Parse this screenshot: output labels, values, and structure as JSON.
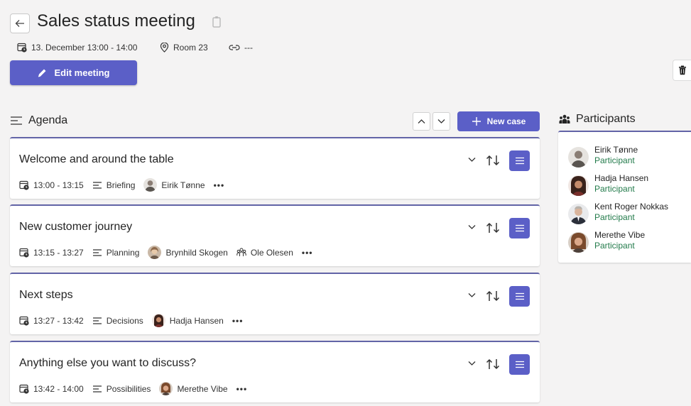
{
  "header": {
    "title": "Sales status meeting",
    "date_time": "13. December 13:00 - 14:00",
    "location": "Room 23",
    "link": "---",
    "edit_label": "Edit meeting"
  },
  "agenda": {
    "heading": "Agenda",
    "new_case_label": "New case",
    "items": [
      {
        "title": "Welcome and around the table",
        "time": "13:00 - 13:15",
        "category": "Briefing",
        "owner": "Eirik Tønne",
        "group": ""
      },
      {
        "title": "New customer journey",
        "time": "13:15 - 13:27",
        "category": "Planning",
        "owner": "Brynhild Skogen",
        "group": "Ole Olesen"
      },
      {
        "title": "Next steps",
        "time": "13:27 - 13:42",
        "category": "Decisions",
        "owner": "Hadja Hansen",
        "group": ""
      },
      {
        "title": "Anything else you want to discuss?",
        "time": "13:42 - 14:00",
        "category": "Possibilities",
        "owner": "Merethe Vibe",
        "group": ""
      }
    ]
  },
  "participants": {
    "heading": "Participants",
    "items": [
      {
        "name": "Eirik Tønne",
        "role": "Participant"
      },
      {
        "name": "Hadja Hansen",
        "role": "Participant"
      },
      {
        "name": "Kent Roger Nokkas",
        "role": "Participant"
      },
      {
        "name": "Merethe Vibe",
        "role": "Participant"
      }
    ]
  },
  "colors": {
    "accent": "#5b5fc7",
    "card_border": "#6264a7",
    "participant_role": "#237b4b",
    "background": "#f4f3f3"
  },
  "icons": {
    "back": "arrow-left-icon",
    "copy": "copy-icon",
    "calendar": "calendar-clock-icon",
    "location": "location-pin-icon",
    "link": "link-icon",
    "edit": "pencil-icon",
    "delete": "trash-icon",
    "agenda": "list-icon",
    "participants": "people-icon"
  }
}
